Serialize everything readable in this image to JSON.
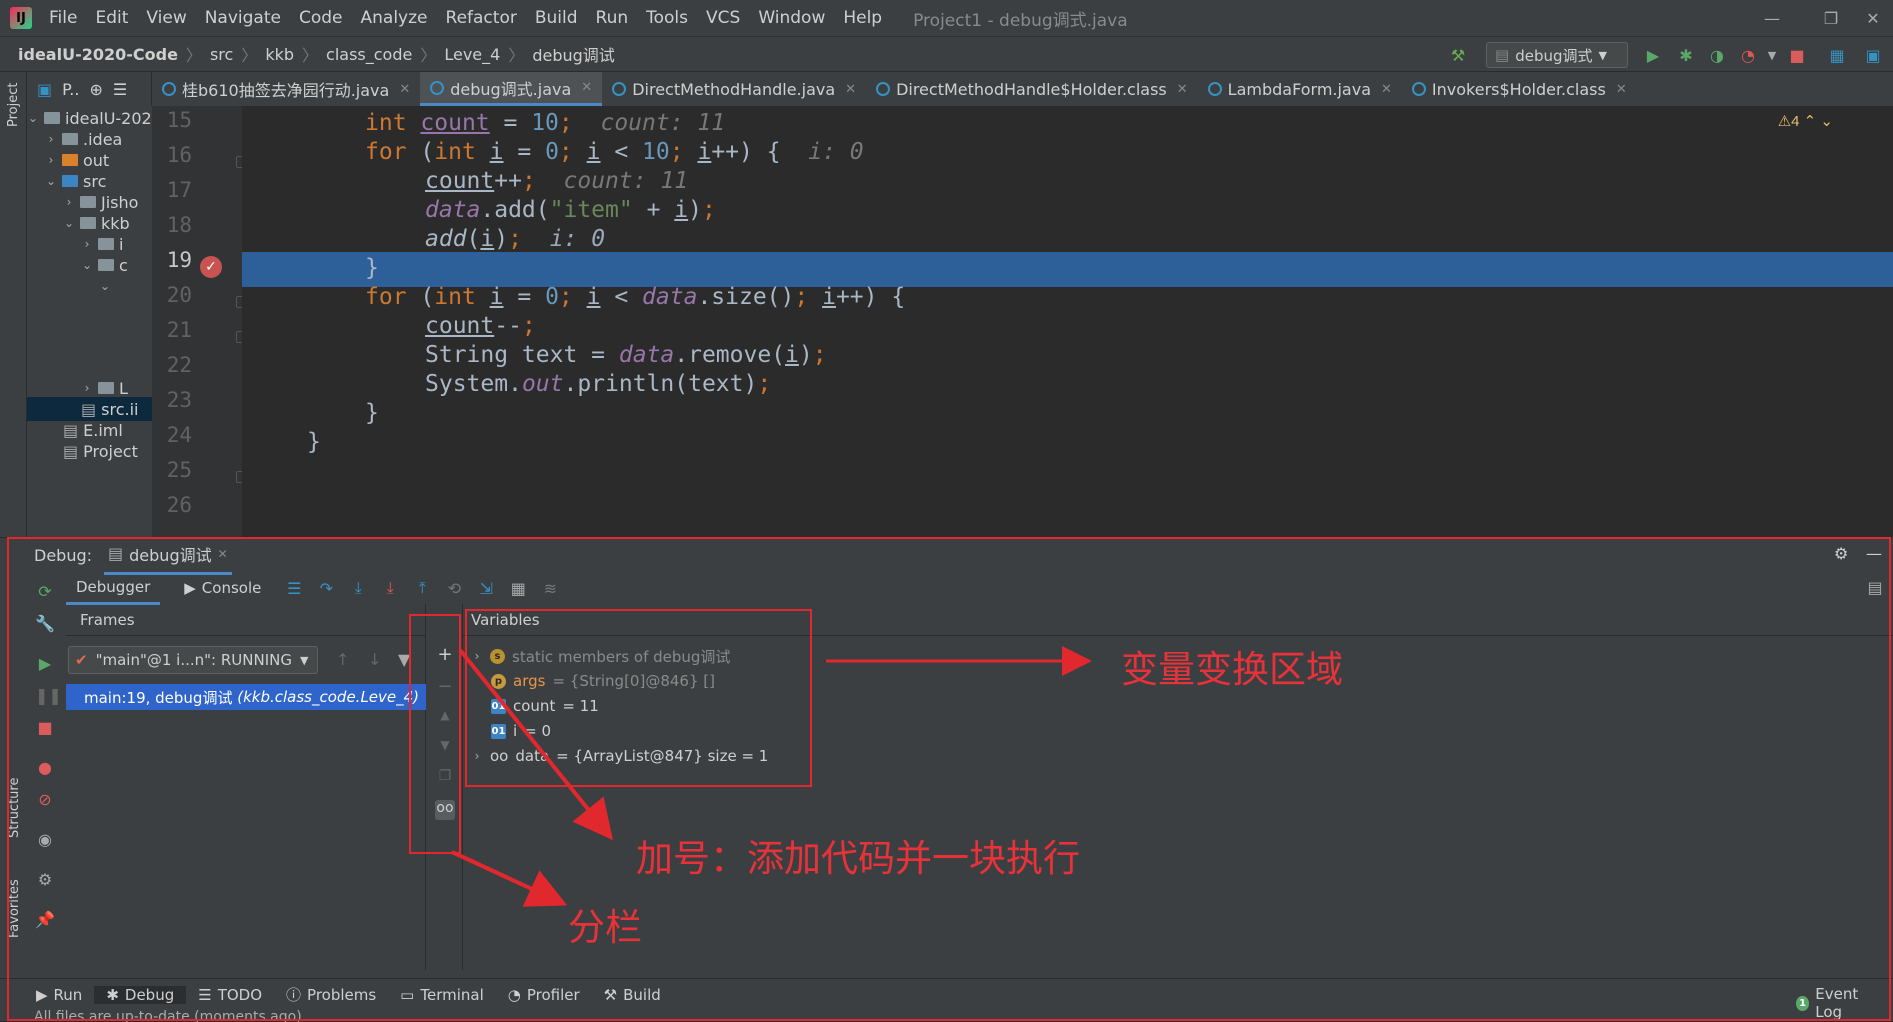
{
  "menubar": {
    "items": [
      "File",
      "Edit",
      "View",
      "Navigate",
      "Code",
      "Analyze",
      "Refactor",
      "Build",
      "Run",
      "Tools",
      "VCS",
      "Window",
      "Help"
    ],
    "window_title": "Project1 - debug调式.java"
  },
  "navbar": {
    "crumbs": [
      "idealU-2020-Code",
      "src",
      "kkb",
      "class_code",
      "Leve_4",
      "debug调试"
    ],
    "run_config": "debug调式"
  },
  "sidebar": {
    "project_label": "Project",
    "structure_label": "Structure",
    "favorites_label": "Favorites"
  },
  "project_header": "P..",
  "tabs": [
    "桂b610抽签去净园行动.java",
    "debug调式.java",
    "DirectMethodHandle.java",
    "DirectMethodHandle$Holder.class",
    "LambdaForm.java",
    "Invokers$Holder.class"
  ],
  "project_tree": [
    {
      "label": "idealU-202",
      "kind": "root"
    },
    {
      "label": ".idea",
      "kind": "folder"
    },
    {
      "label": "out",
      "kind": "folder-orange"
    },
    {
      "label": "src",
      "kind": "folder-blue"
    },
    {
      "label": "Jisho",
      "kind": "folder"
    },
    {
      "label": "kkb",
      "kind": "folder"
    },
    {
      "label": "i",
      "kind": "folder"
    },
    {
      "label": "c",
      "kind": "folder"
    },
    {
      "label": "L",
      "kind": "folder"
    },
    {
      "label": "src.ii",
      "kind": "file"
    },
    {
      "label": "E.iml",
      "kind": "file"
    },
    {
      "label": "Project",
      "kind": "file"
    }
  ],
  "editor": {
    "line_numbers": [
      "15",
      "16",
      "17",
      "18",
      "19",
      "20",
      "21",
      "22",
      "23",
      "24",
      "25",
      "26"
    ],
    "current_line": "19",
    "warning_count": "4",
    "hints": {
      "l15": "count: 11",
      "l16": "i: 0",
      "l17": "count: 11",
      "l19": "i: 0"
    }
  },
  "debug": {
    "label": "Debug:",
    "session_tab": "debug调试",
    "debugger_tab": "Debugger",
    "console_tab": "Console",
    "frames_header": "Frames",
    "thread_selector": "\"main\"@1 i...n\": RUNNING",
    "selected_frame": "main:19, debug调试",
    "selected_frame_loc": "(kkb.class_code.Leve_4)",
    "variables_header": "Variables",
    "variables": [
      {
        "badge": "s",
        "name": "static members of debug调试",
        "value": ""
      },
      {
        "badge": "p",
        "name": "args",
        "value": "= {String[0]@846} []"
      },
      {
        "badge": "01",
        "name": "count",
        "value": "= 11"
      },
      {
        "badge": "01",
        "name": "i",
        "value": "= 0"
      },
      {
        "badge": "oo",
        "name": "data",
        "value": "= {ArrayList@847}  size = 1"
      }
    ]
  },
  "bottom_tabs": [
    "Run",
    "Debug",
    "TODO",
    "Problems",
    "Terminal",
    "Profiler",
    "Build"
  ],
  "event_log": "Event Log",
  "event_log_count": "1",
  "status_text": "All files are up-to-date (moments ago)",
  "annotations": {
    "variables_area": "变量变换区域",
    "plus_sign": "加号：添加代码并一块执行",
    "split": "分栏"
  },
  "colors": {
    "annotation_red": "#e0282e",
    "selection_blue": "#2d6099",
    "keyword": "#cc7832",
    "number": "#6897bb"
  }
}
